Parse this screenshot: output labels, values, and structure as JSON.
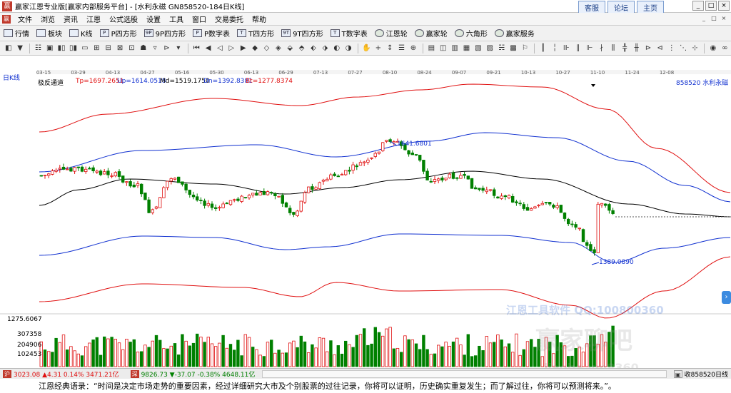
{
  "window": {
    "title": "赢家江恩专业版[赢家内部服务平台] - [水利永磁  GN858520-184日K线]",
    "tabs": [
      "客服",
      "论坛",
      "主页"
    ],
    "controls": [
      "_",
      "□",
      "×"
    ]
  },
  "menu": {
    "items": [
      "文件",
      "浏览",
      "资讯",
      "江恩",
      "公式选股",
      "设置",
      "工具",
      "窗口",
      "交易委托",
      "帮助"
    ],
    "mdi_controls": [
      "_",
      "□",
      "×"
    ]
  },
  "toolbar1": {
    "items": [
      {
        "label": "行情",
        "icon": "quote-icon"
      },
      {
        "label": "板块",
        "icon": "sector-icon"
      },
      {
        "label": "K线",
        "icon": "kline-icon"
      },
      {
        "label": "P四方形",
        "icon": "p-square-icon",
        "glyph": "P"
      },
      {
        "label": "9P四方形",
        "icon": "9p-square-icon",
        "glyph": "9P"
      },
      {
        "label": "P数字表",
        "icon": "p-table-icon",
        "glyph": "P"
      },
      {
        "label": "T四方形",
        "icon": "t-square-icon",
        "glyph": "T"
      },
      {
        "label": "9T四方形",
        "icon": "9t-square-icon",
        "glyph": "9T"
      },
      {
        "label": "T数字表",
        "icon": "t-table-icon",
        "glyph": "T"
      },
      {
        "label": "江恩轮",
        "icon": "gann-wheel-icon"
      },
      {
        "label": "赢家轮",
        "icon": "winner-wheel-icon"
      },
      {
        "label": "六角形",
        "icon": "hexagon-icon"
      },
      {
        "label": "赢家服务",
        "icon": "service-icon"
      }
    ]
  },
  "toolbar2": {
    "groups": [
      [
        "◧",
        "▼"
      ],
      [
        "☷",
        "▣",
        "▮▯",
        "▯▮",
        "▭",
        "⊞",
        "⊟",
        "⊠",
        "⊡",
        "☗",
        "▿",
        "⊳",
        "▾"
      ],
      [
        "⏮",
        "◀",
        "◁",
        "▷",
        "▶",
        "◆",
        "◇",
        "◈",
        "⬙",
        "⬘",
        "⬖",
        "⬗",
        "◐",
        "◑"
      ],
      [
        "✋",
        "+",
        "↕",
        "☰",
        "⊕"
      ],
      [
        "▤",
        "◫",
        "▥",
        "▦",
        "▧",
        "▨",
        "☵",
        "▩",
        "⚐"
      ],
      [
        "┃",
        "╎",
        "⊪",
        "∥",
        "⊩",
        "∤",
        "⫼",
        "╬",
        "╫",
        "⊳",
        "⊲",
        "⋮",
        "⋱",
        "⊹"
      ],
      [
        "◉",
        "∞"
      ]
    ]
  },
  "chart": {
    "period_label": "日K线",
    "indicator_name": "极反通道",
    "indicator_values": [
      {
        "label": "Tp=1697.2651",
        "color": "#e01010"
      },
      {
        "label": "Up=1614.0518",
        "color": "#1030d0"
      },
      {
        "label": "Md=1519.1750",
        "color": "#000000"
      },
      {
        "label": "Dn=1392.8381",
        "color": "#1030d0"
      },
      {
        "label": "Bt=1277.8374",
        "color": "#e01010"
      }
    ],
    "stock_label": "858520  水利永磁",
    "date_ticks": [
      "03-15",
      "03-29",
      "04-13",
      "04-27",
      "05-16",
      "05-30",
      "06-13",
      "06-29",
      "07-13",
      "07-27",
      "08-10",
      "08-24",
      "09-07",
      "09-21",
      "10-13",
      "10-27",
      "11-10",
      "11-24",
      "12-08"
    ],
    "high_marker": "1641.6801",
    "low_marker": "1389.0890",
    "volume_max": "1275.6067",
    "volume_ticks": [
      "307358",
      "204906",
      "102453"
    ],
    "colors": {
      "up": "#e01010",
      "down": "#008000",
      "upper_band": "#e01010",
      "mid_band": "#1030d0",
      "center": "#000000"
    }
  },
  "watermark": {
    "line1": "江恩工具软件  QQ:100800360",
    "line2": "赢家聊吧",
    "line3": "liaoba.vm8360"
  },
  "statusbar": {
    "items": [
      {
        "icon": "shanghai-index-icon",
        "text": "3023.08 ▲4.31 0.14% 3471.21亿",
        "color": "#e01010"
      },
      {
        "icon": "shenzhen-index-icon",
        "text": "9826.73 ▼-37.07 -0.38% 4648.11亿",
        "color": "#008000"
      }
    ],
    "right_text": "收858520日线"
  },
  "quote": {
    "text": "江恩经典语录：“时间是决定市场走势的重要因素，经过详细研究大市及个别股票的过往记录，你将可以证明，历史确实重复发生；而了解过往，你将可以预测将来。”。"
  }
}
